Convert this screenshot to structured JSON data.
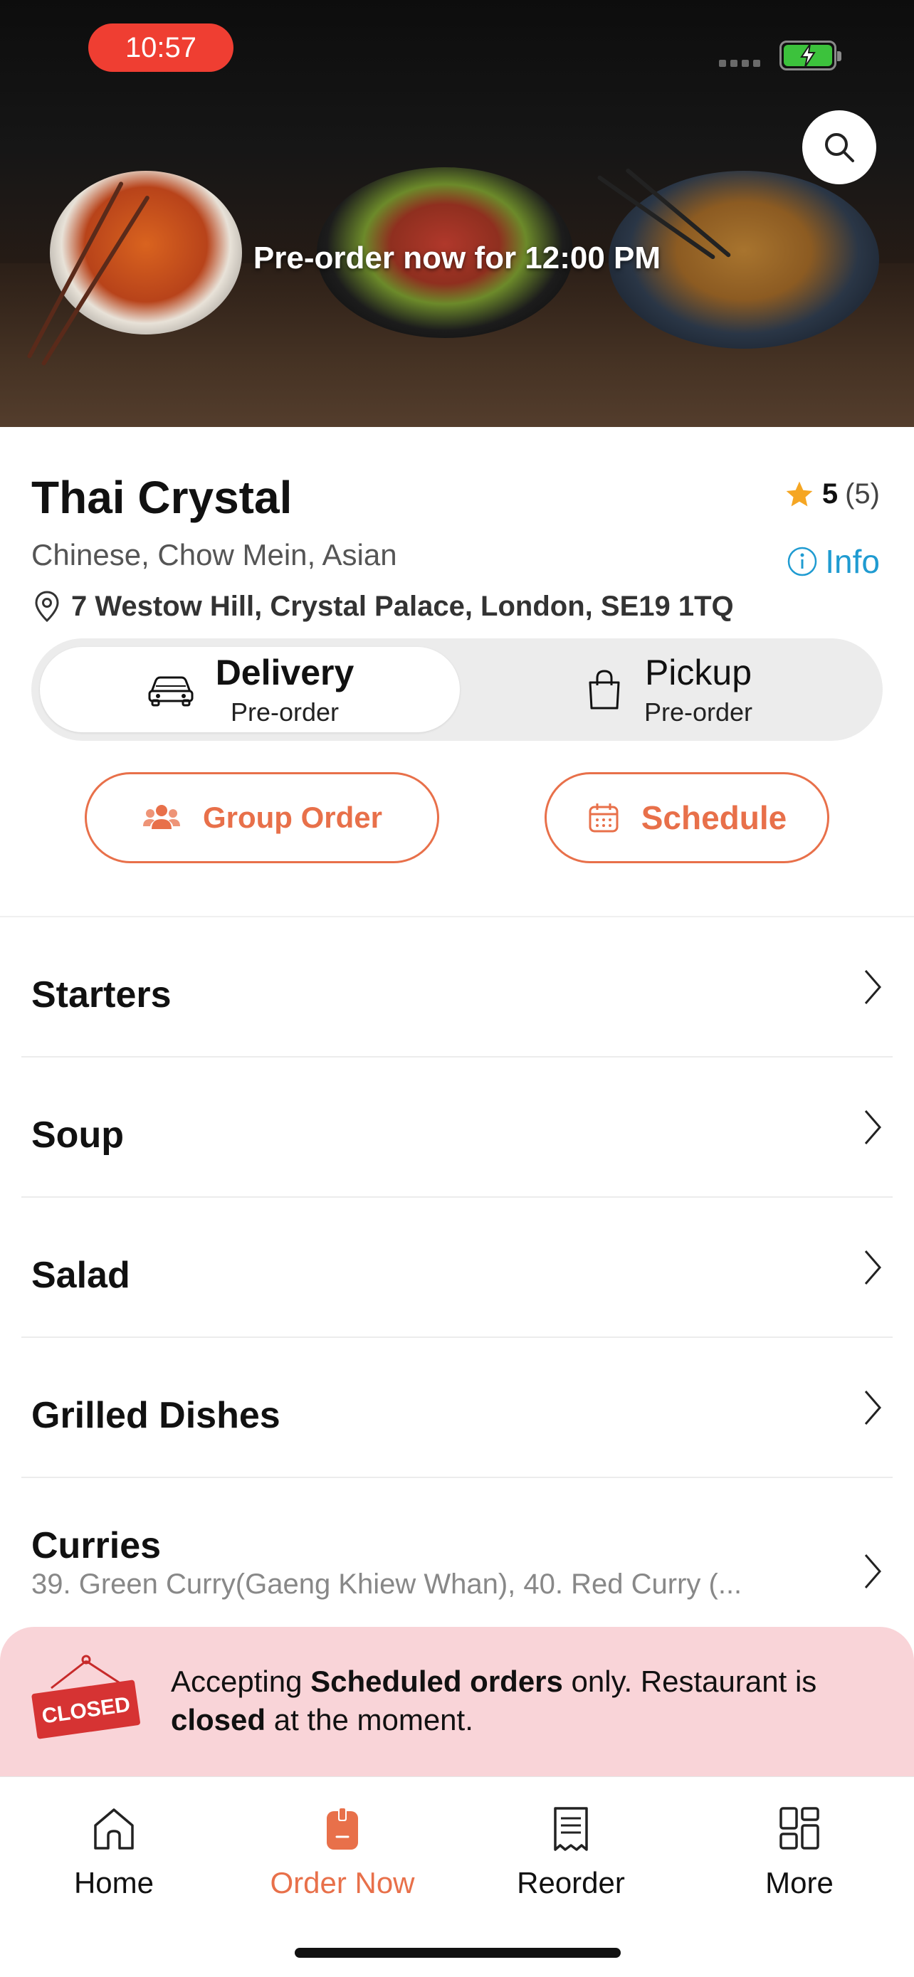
{
  "status_bar": {
    "time": "10:57"
  },
  "hero": {
    "banner_text": "Pre-order now for 12:00 PM"
  },
  "restaurant": {
    "name": "Thai Crystal",
    "rating": "5",
    "rating_count": "(5)",
    "cuisines": "Chinese, Chow Mein, Asian",
    "info_label": "Info",
    "address": "7 Westow Hill, Crystal Palace, London, SE19 1TQ"
  },
  "order_mode": {
    "delivery": {
      "label": "Delivery",
      "sub": "Pre-order",
      "selected": true
    },
    "pickup": {
      "label": "Pickup",
      "sub": "Pre-order",
      "selected": false
    }
  },
  "actions": {
    "group_order": "Group Order",
    "schedule": "Schedule"
  },
  "menu": {
    "categories": [
      {
        "label": "Starters"
      },
      {
        "label": "Soup"
      },
      {
        "label": "Salad"
      },
      {
        "label": "Grilled Dishes"
      },
      {
        "label": "Curries",
        "preview": "39. Green Curry(Gaeng Khiew Whan), 40. Red Curry (..."
      }
    ]
  },
  "closed_banner": {
    "sign_text": "CLOSED",
    "part1": "Accepting ",
    "bold1": "Scheduled orders",
    "part2": " only. Restaurant is ",
    "bold2": "closed",
    "part3": " at the moment."
  },
  "tabbar": {
    "items": [
      {
        "label": "Home",
        "icon": "home-icon"
      },
      {
        "label": "Order Now",
        "icon": "order-icon",
        "active": true
      },
      {
        "label": "Reorder",
        "icon": "receipt-icon"
      },
      {
        "label": "More",
        "icon": "grid-icon"
      }
    ]
  },
  "colors": {
    "accent": "#e8704a",
    "info": "#1f9bd1",
    "banner_bg": "#f9d4d8",
    "star": "#f5a623"
  }
}
